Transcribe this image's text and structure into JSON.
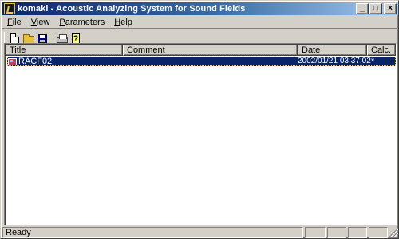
{
  "window": {
    "title": "komaki - Acoustic Analyzing System for Sound Fields",
    "buttons": {
      "minimize": "_",
      "maximize": "□",
      "close": "×"
    }
  },
  "menu": [
    {
      "label": "File",
      "key": "F",
      "rest": "ile"
    },
    {
      "label": "View",
      "key": "V",
      "rest": "iew"
    },
    {
      "label": "Parameters",
      "key": "P",
      "rest": "arameters"
    },
    {
      "label": "Help",
      "key": "H",
      "rest": "elp"
    }
  ],
  "toolbar": {
    "icons": [
      "new-file-icon",
      "open-folder-icon",
      "save-disk-icon",
      "print-icon",
      "help-icon"
    ],
    "help_glyph": "?"
  },
  "list": {
    "columns": {
      "title": "Title",
      "comment": "Comment",
      "date": "Date",
      "calc": "Calc."
    },
    "rows": [
      {
        "title": "RACF02",
        "comment": "",
        "date": "2002/01/21 03:37:02",
        "calc": "*"
      }
    ],
    "selection_color": "#0a246a"
  },
  "status": {
    "text": "Ready"
  }
}
